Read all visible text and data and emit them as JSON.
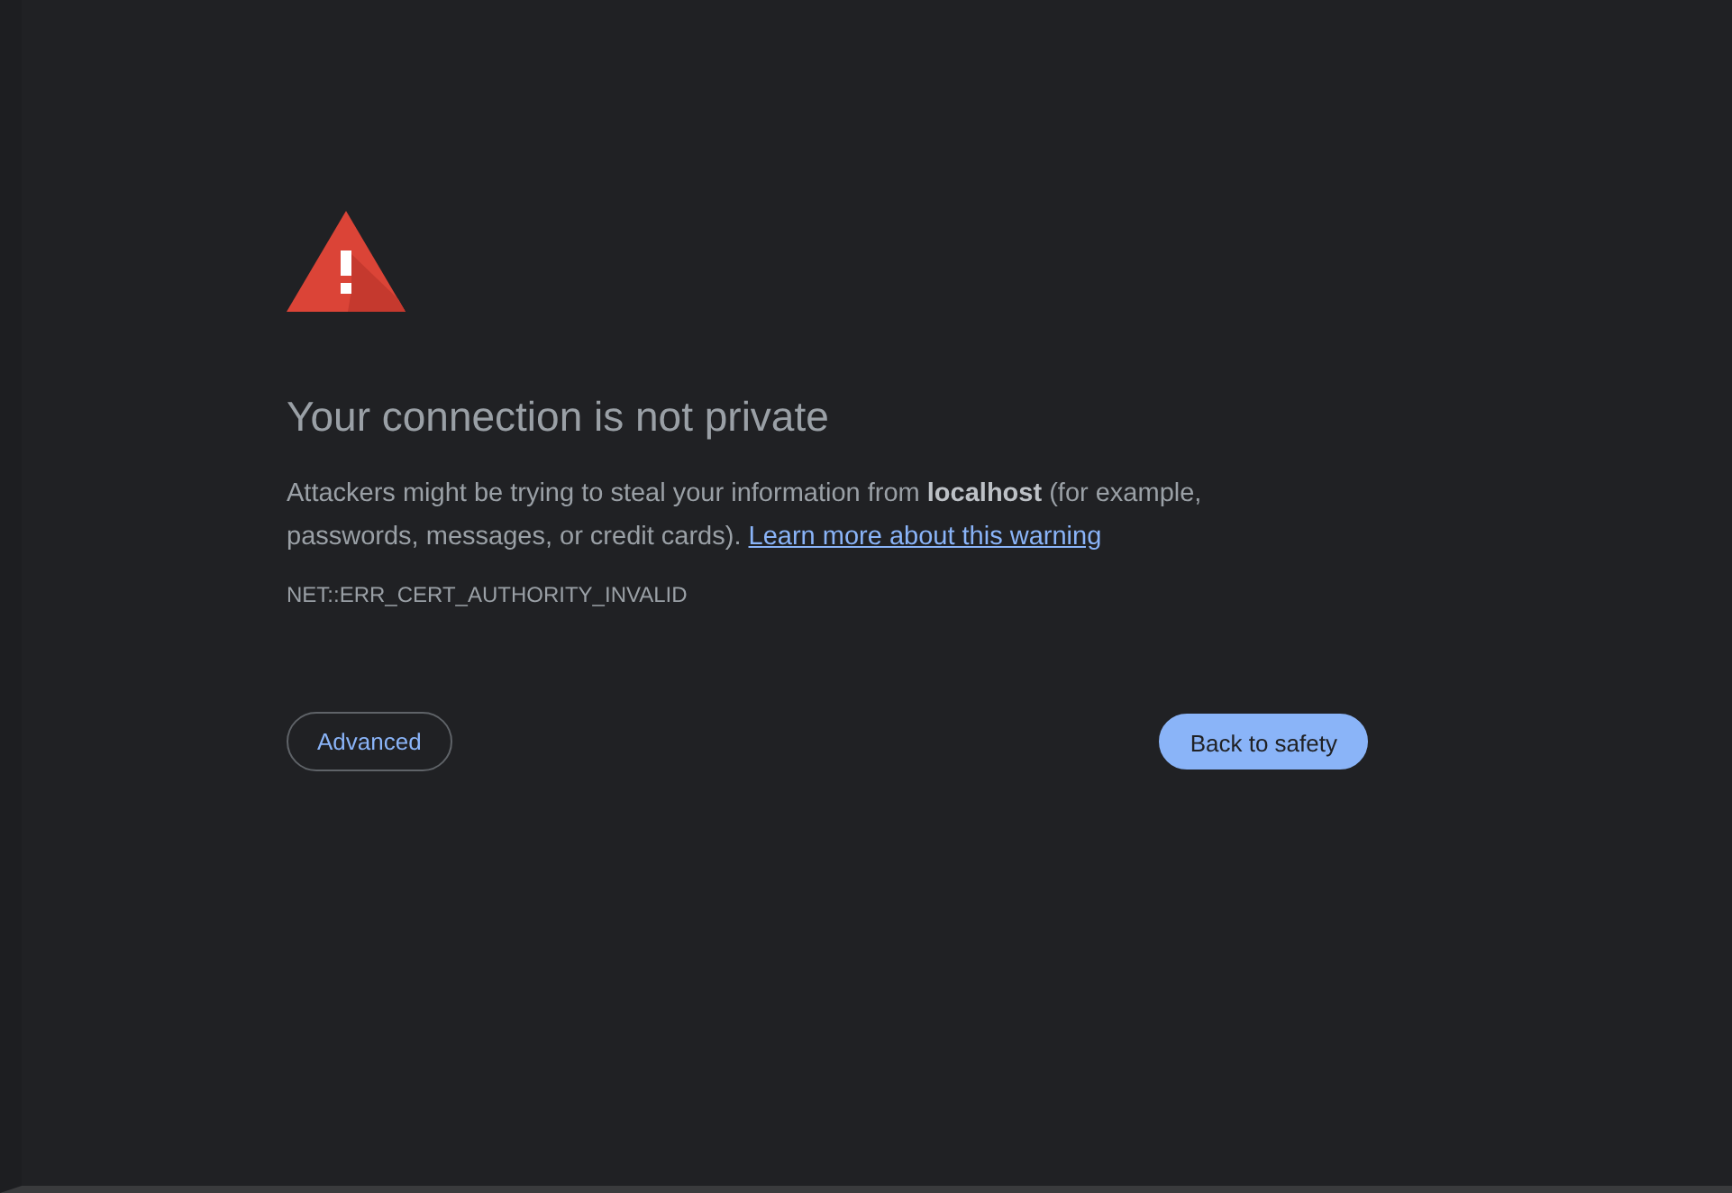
{
  "heading": "Your connection is not private",
  "message": "Attackers might be trying to steal your information from **localhost** (for example, passwords, messages, or credit cards).",
  "learn_more_link": "Learn more about this warning",
  "error_code": "NET::ERR_CERT_AUTHORITY_INVALID",
  "buttons": [
    {
      "kind": "secondary",
      "label": "Advanced"
    },
    {
      "kind": "primary",
      "label": "Back to safety"
    }
  ]
}
